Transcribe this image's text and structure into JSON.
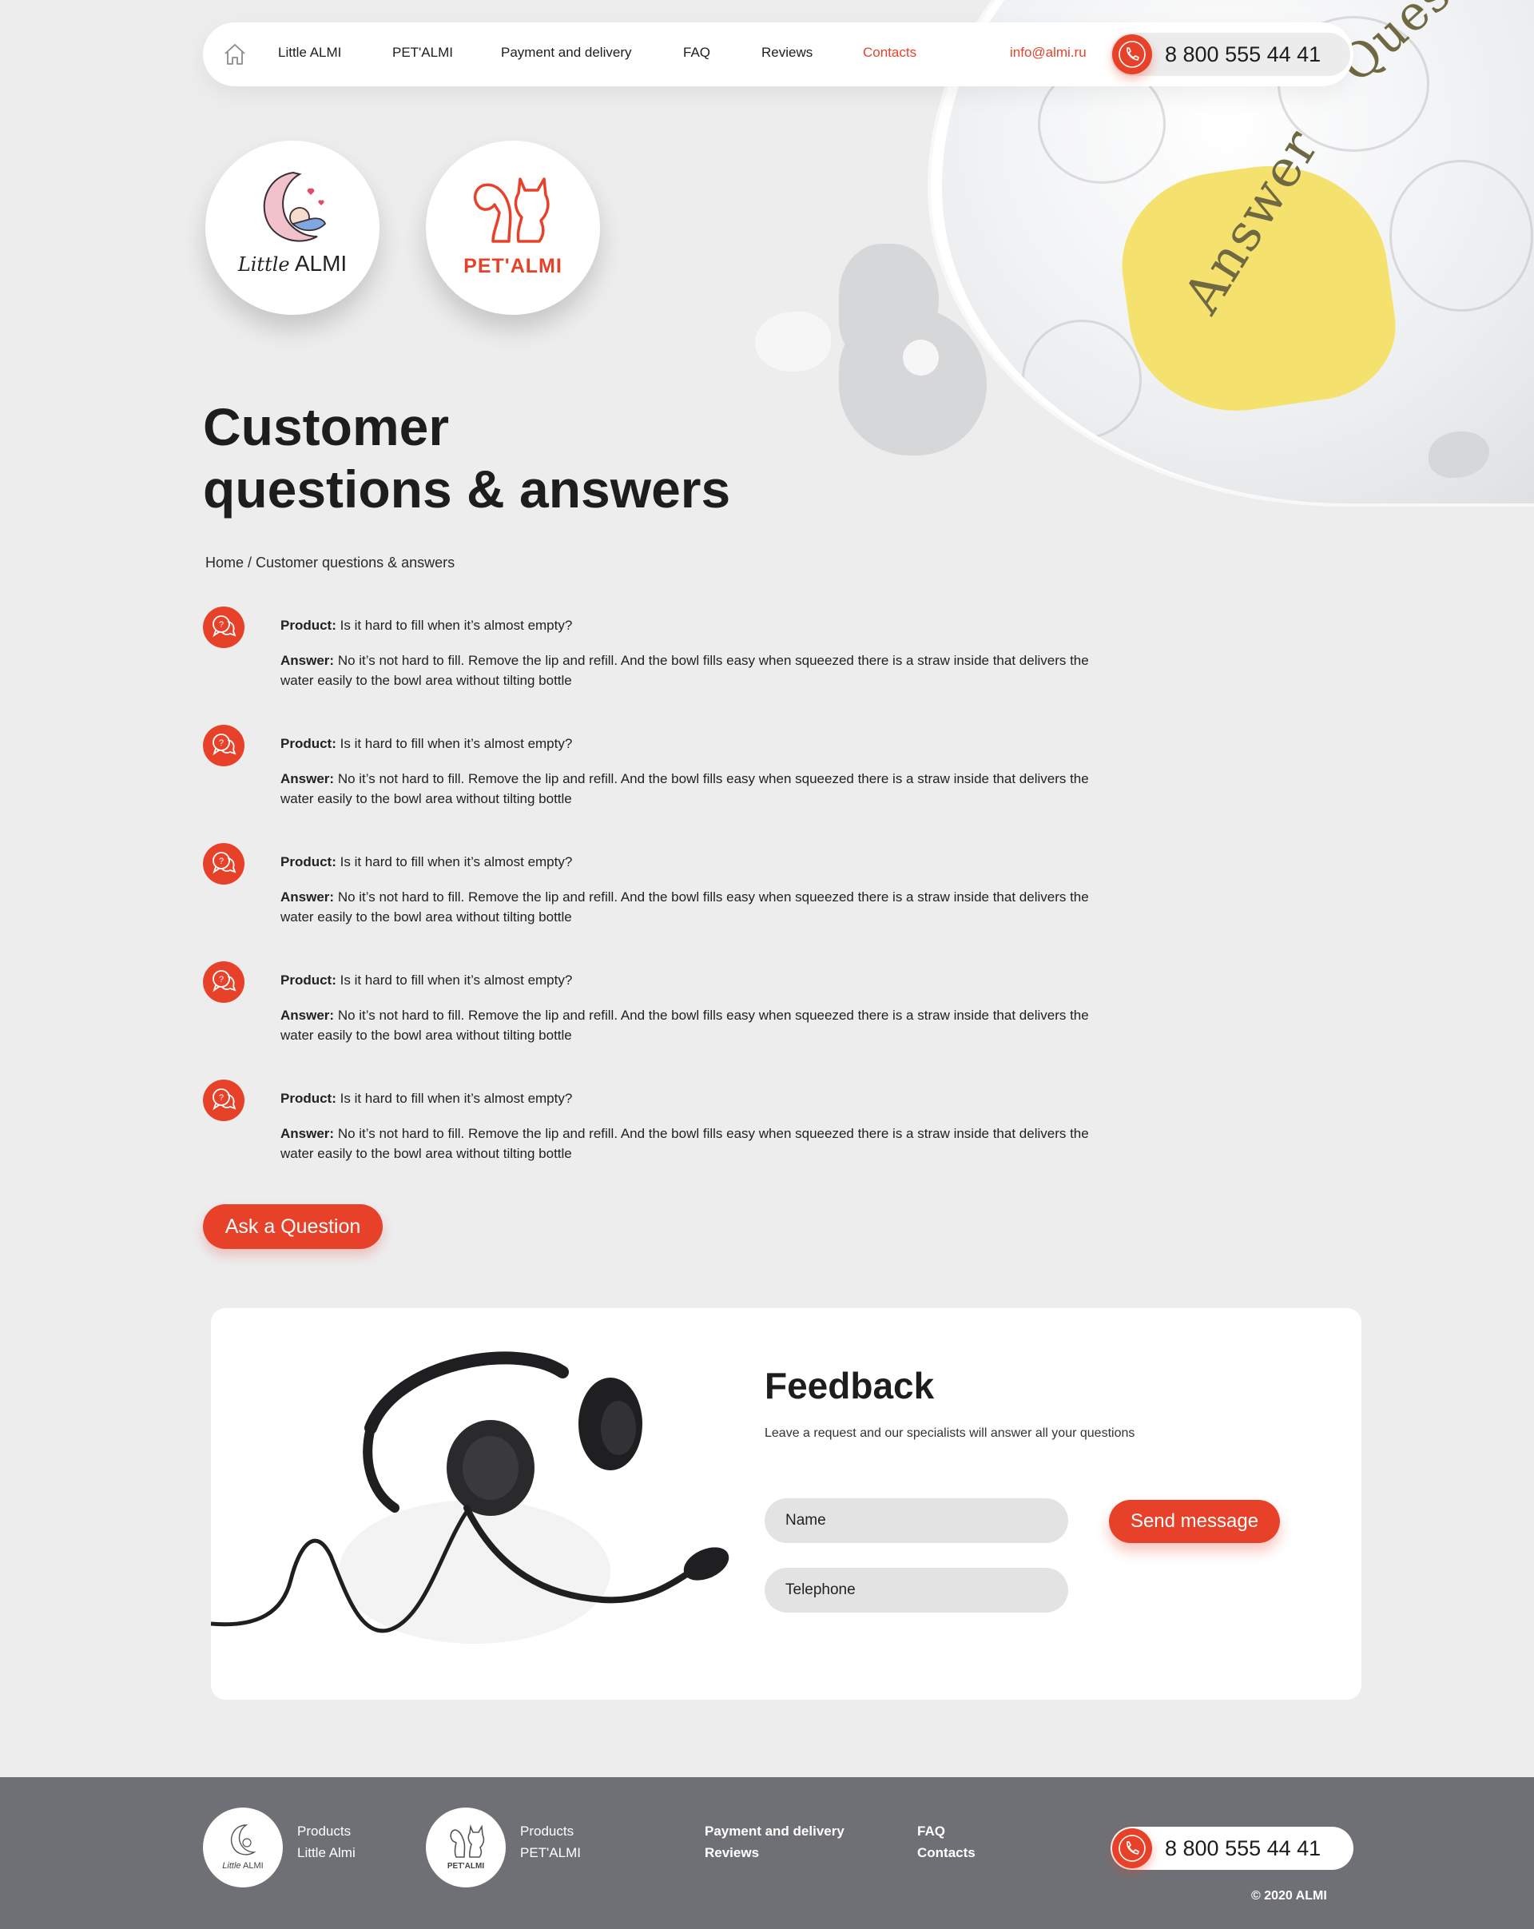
{
  "nav": {
    "items": [
      {
        "label": "Little ALMI"
      },
      {
        "label": "PET'ALMI"
      },
      {
        "label": "Payment and delivery"
      },
      {
        "label": "FAQ"
      },
      {
        "label": "Reviews"
      },
      {
        "label": "Contacts"
      }
    ],
    "email": "info@almi.ru",
    "phone": "8 800 555 44 41"
  },
  "brands": {
    "little_label_a": "Little",
    "little_label_b": "ALMI",
    "pet_label": "PET'ALMI"
  },
  "hero_image": {
    "word_answer": "Answer",
    "word_question": "Question"
  },
  "page": {
    "title_line1": "Customer",
    "title_line2": "questions & answers",
    "breadcrumb": "Home / Customer questions & answers"
  },
  "qa": [
    {
      "product_label": "Product:",
      "question": "Is it hard to fill when it’s almost empty?",
      "answer_label": "Answer:",
      "answer": "No it’s not hard to fill. Remove the lip and refill. And the bowl fills easy when squeezed there is a straw inside that delivers the water easily to the bowl area without tilting bottle"
    },
    {
      "product_label": "Product:",
      "question": "Is it hard to fill when it’s almost empty?",
      "answer_label": "Answer:",
      "answer": "No it’s not hard to fill. Remove the lip and refill. And the bowl fills easy when squeezed there is a straw inside that delivers the water easily to the bowl area without tilting bottle"
    },
    {
      "product_label": "Product:",
      "question": "Is it hard to fill when it’s almost empty?",
      "answer_label": "Answer:",
      "answer": "No it’s not hard to fill. Remove the lip and refill. And the bowl fills easy when squeezed there is a straw inside that delivers the water easily to the bowl area without tilting bottle"
    },
    {
      "product_label": "Product:",
      "question": "Is it hard to fill when it’s almost empty?",
      "answer_label": "Answer:",
      "answer": "No it’s not hard to fill. Remove the lip and refill. And the bowl fills easy when squeezed there is a straw inside that delivers the water easily to the bowl area without tilting bottle"
    },
    {
      "product_label": "Product:",
      "question": "Is it hard to fill when it’s almost empty?",
      "answer_label": "Answer:",
      "answer": "No it’s not hard to fill. Remove the lip and refill. And the bowl fills easy when squeezed there is a straw inside that delivers the water easily to the bowl area without tilting bottle"
    }
  ],
  "ask_button": "Ask a Question",
  "feedback": {
    "title": "Feedback",
    "subtitle": "Leave a request and our specialists will answer all your questions",
    "name_placeholder": "Name",
    "phone_placeholder": "Telephone",
    "send_button": "Send message"
  },
  "footer": {
    "col1": [
      "Products",
      "Little Almi"
    ],
    "col2": [
      "Products",
      "PET'ALMI"
    ],
    "col3": [
      "Payment and delivery",
      "Reviews"
    ],
    "col4": [
      "FAQ",
      "Contacts"
    ],
    "phone": "8 800 555 44 41",
    "copyright": "© 2020 ALMI",
    "little_logo_a": "Little",
    "little_logo_b": "ALMI",
    "pet_logo": "PET'ALMI"
  },
  "colors": {
    "accent": "#e8412a",
    "background": "#ededee",
    "footer": "#6f7075"
  },
  "icons": [
    "home-icon",
    "phone-icon",
    "question-chat-icon"
  ]
}
